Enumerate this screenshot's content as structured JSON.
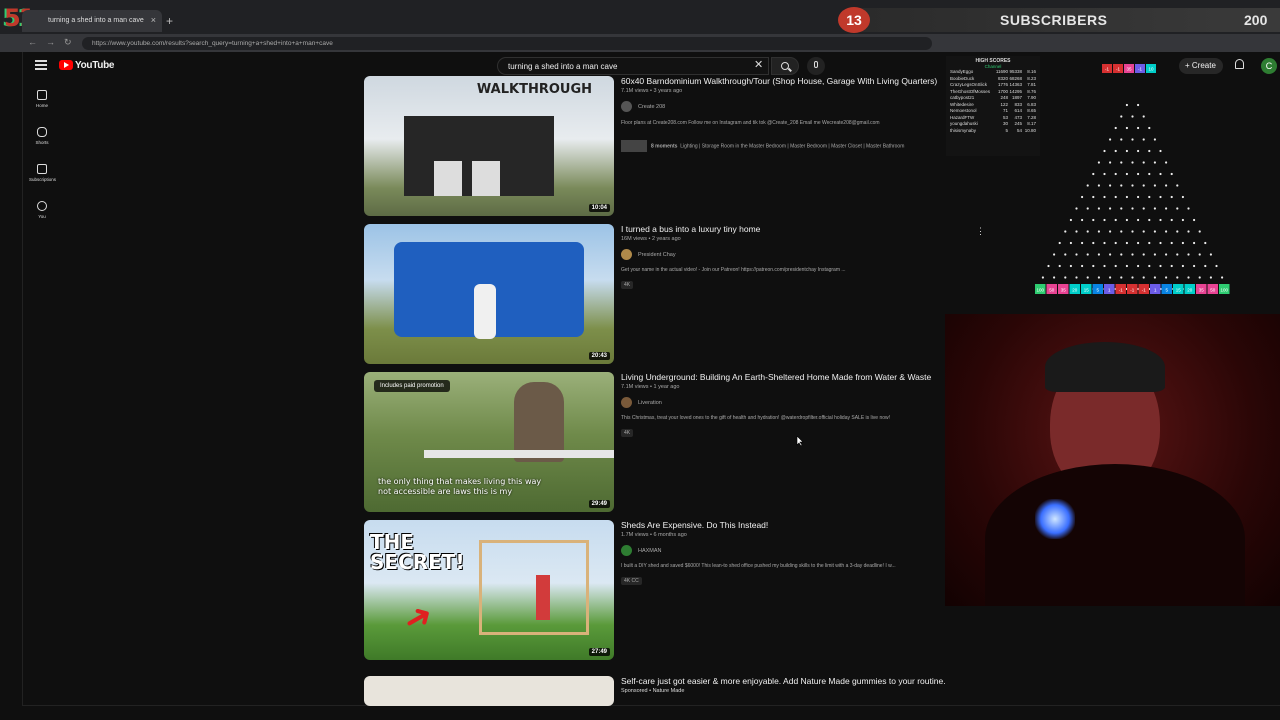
{
  "browser": {
    "tab_title": "turning a shed into a man cave",
    "tab_close": "×",
    "new_tab": "+",
    "url": "https://www.youtube.com/results?search_query=turning+a+shed+into+a+man+cave",
    "back": "←",
    "forward": "→",
    "reload": "↻"
  },
  "overlay": {
    "corner_number": "51",
    "subscriber_count": "13",
    "subscriber_label": "SUBSCRIBERS",
    "subscriber_goal": "200"
  },
  "youtube": {
    "logo_text": "YouTube",
    "search_query": "turning a shed into a man cave",
    "search_clear": "✕",
    "create_label": "Create",
    "avatar_letter": "C",
    "sidebar": [
      {
        "label": "Home",
        "icon": "home-icon"
      },
      {
        "label": "Shorts",
        "icon": "shorts-icon"
      },
      {
        "label": "Subscriptions",
        "icon": "subscriptions-icon"
      },
      {
        "label": "You",
        "icon": "you-icon"
      }
    ],
    "results": [
      {
        "title": "60x40 Barndominium Walkthrough/Tour (Shop House, Garage With Living Quarters)",
        "meta": "7.1M views • 3 years ago",
        "channel": "Create 208",
        "description": "Floor plans at Create208.com Follow me on Instagram and tik tok @Create_208 Email me Wecreate208@gmail.com",
        "moments": "8 moments",
        "moments_text": "Lighting | Storage Room in the Master Bedroom | Master Bedroom | Master Closet | Master Bathroom",
        "thumb_caption": "WALKTHROUGH",
        "duration": "10:04"
      },
      {
        "title": "I turned a bus into a luxury tiny home",
        "meta": "16M views • 2 years ago",
        "channel": "President Chay",
        "description": "Get your name in the actual video! - Join our Patreon! https://patreon.com/presidentchay Instagram ...",
        "badge": "4K",
        "duration": "20:43"
      },
      {
        "title": "Living Underground: Building An Earth-Sheltered Home Made from Water & Waste",
        "meta": "7.1M views • 1 year ago",
        "channel": "Liveration",
        "description": "This Christmas, treat your loved ones to the gift of health and hydration! @waterdropfilter.official holiday SALE is live now!",
        "badge": "4K",
        "paid_promo": "Includes paid promotion",
        "thumb_caption": "the only thing that makes living this way not accessible are laws this is my",
        "duration": "29:49"
      },
      {
        "title": "Sheds Are Expensive. Do This Instead!",
        "meta": "1.7M views • 6 months ago",
        "channel": "HAXMAN",
        "description": "I built a DIY shed and saved $6000! This lean-to shed office pushed my building skills to the limit with a 3-day deadline! I w...",
        "badge": "4K  CC",
        "thumb_caption": "THE SECRET!",
        "duration": "27:49"
      },
      {
        "title": "Self-care just got easier & more enjoyable. Add Nature Made gummies to your routine.",
        "meta": "Sponsored • Nature Made"
      }
    ]
  },
  "highscores": {
    "title": "HIGH SCORES",
    "subtitle": "Channel",
    "rows": [
      [
        "SandyEggo",
        "11690",
        "95338",
        "8.16"
      ],
      [
        "BoobieDuck",
        "8320",
        "68268",
        "8.23"
      ],
      [
        "CrazyLegsOnSlick",
        "1776",
        "14363",
        "7.81"
      ],
      [
        "TheGhostOfMosses",
        "1700",
        "14295",
        "8.76"
      ],
      [
        "catbypost21",
        "248",
        "1897",
        "7.90"
      ],
      [
        "Whitedesire",
        "122",
        "833",
        "6.83"
      ],
      [
        "Nemoestonol",
        "71",
        "614",
        "8.65"
      ],
      [
        "HazardFTW",
        "53",
        "473",
        "7.28"
      ],
      [
        "youngdahuski",
        "30",
        "245",
        "8.17"
      ],
      [
        "thisismynaby",
        "5",
        "54",
        "10.80"
      ]
    ]
  },
  "plinko": {
    "slots": [
      "100",
      "50",
      "35",
      "20",
      "15",
      "5",
      "1",
      "-1",
      "-1",
      "-1",
      "1",
      "5",
      "15",
      "20",
      "35",
      "50",
      "100"
    ],
    "top_slots": [
      "-1",
      "-1",
      "35",
      "-1",
      "10"
    ]
  },
  "colors": {
    "page_bg": "#0f0f0f",
    "yt_red": "#ff0000",
    "overlay_red": "#c0392b",
    "webcam_red": "#5a1414"
  }
}
